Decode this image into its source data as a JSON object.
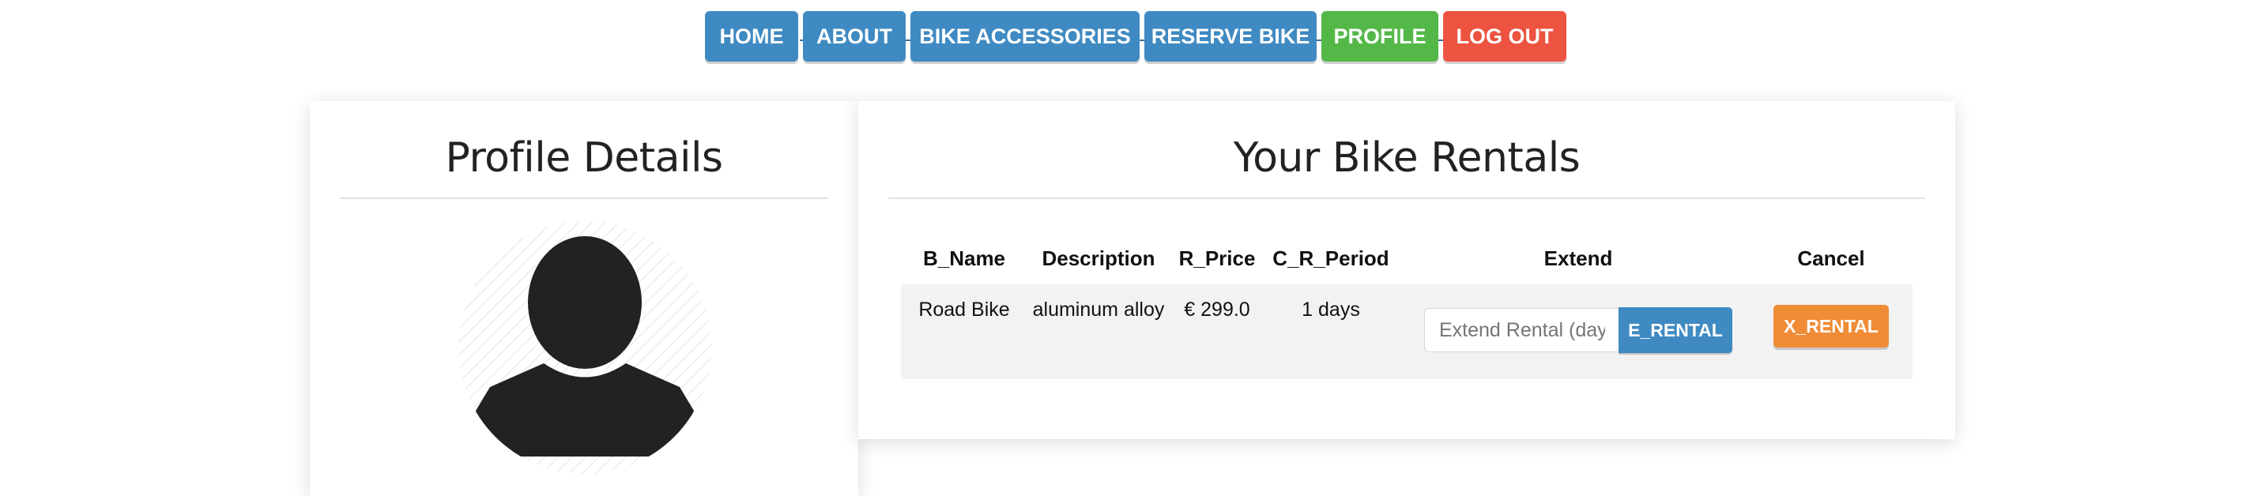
{
  "nav": {
    "home": "HOME",
    "about": "ABOUT",
    "bike_accessories": "BIKE ACCESSORIES",
    "reserve_bike": "RESERVE BIKE",
    "profile": "PROFILE",
    "logout": "LOG OUT"
  },
  "colors": {
    "nav_blue": "#3f8ac2",
    "nav_active_green": "#54b848",
    "logout_red": "#ec5441",
    "cancel_orange": "#f08c36"
  },
  "profile": {
    "title": "Profile Details",
    "avatar_icon": "user-silhouette-icon"
  },
  "rentals": {
    "title": "Your Bike Rentals",
    "columns": [
      "B_Name",
      "Description",
      "R_Price",
      "C_R_Period",
      "Extend",
      "Cancel"
    ],
    "rows": [
      {
        "name": "Road Bike",
        "description": "aluminum alloy",
        "price": "€ 299.0",
        "period": "1 days",
        "extend_placeholder": "Extend Rental (days)",
        "extend_button": "E_RENTAL",
        "cancel_button": "X_RENTAL"
      }
    ]
  }
}
